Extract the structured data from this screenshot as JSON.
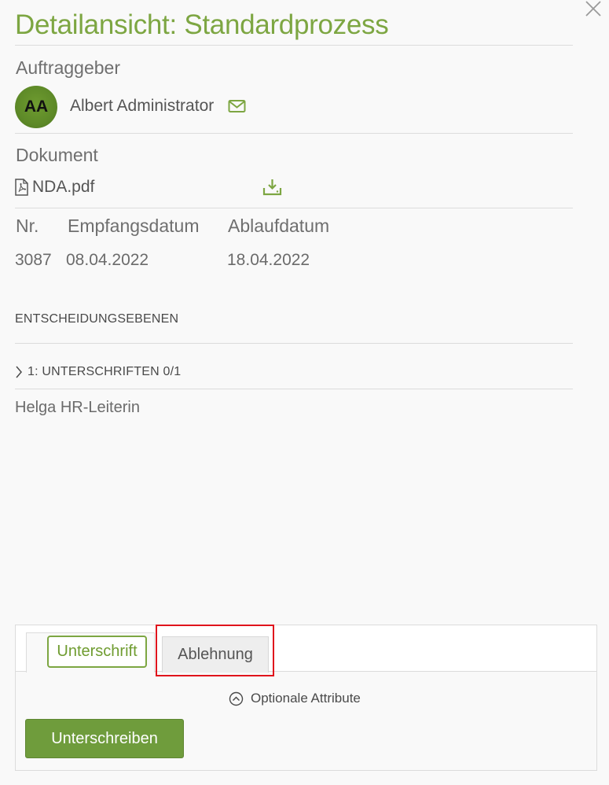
{
  "header": {
    "title": "Detailansicht: Standardprozess",
    "close_icon": "close-icon"
  },
  "client": {
    "heading": "Auftraggeber",
    "avatar_initials": "AA",
    "name": "Albert Administrator",
    "mail_icon": "envelope-icon"
  },
  "document": {
    "heading": "Dokument",
    "file_name": "NDA.pdf",
    "file_icon": "pdf-file-icon",
    "download_icon": "download-icon"
  },
  "details": {
    "columns": [
      "Nr.",
      "Empfangsdatum",
      "Ablaufdatum"
    ],
    "values": [
      "3087",
      "08.04.2022",
      "18.04.2022"
    ]
  },
  "levels": {
    "heading": "ENTSCHEIDUNGSEBENEN",
    "items": [
      {
        "label": "1: UNTERSCHRIFTEN 0/1",
        "signer": "Helga HR-Leiterin"
      }
    ]
  },
  "action_panel": {
    "tabs": [
      {
        "label": "Unterschrift",
        "active": true
      },
      {
        "label": "Ablehnung",
        "active": false
      }
    ],
    "optional_label": "Optionale Attribute",
    "submit_label": "Unterschreiben"
  },
  "colors": {
    "accent": "#7da642",
    "button": "#6f9c3c",
    "highlight": "#e0141c"
  }
}
